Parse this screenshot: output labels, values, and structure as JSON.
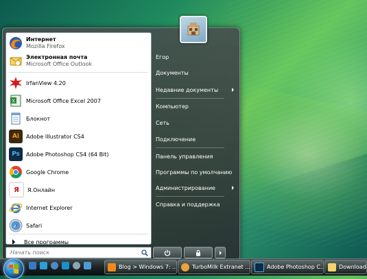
{
  "start_menu": {
    "pinned": [
      {
        "title": "Интернет",
        "subtitle": "Mozilla Firefox",
        "icon": "firefox-icon"
      },
      {
        "title": "Электронная почта",
        "subtitle": "Microsoft Office Outlook",
        "icon": "outlook-icon"
      }
    ],
    "recent": [
      {
        "label": "IrfanView 4.20",
        "icon": "irfanview-icon"
      },
      {
        "label": "Microsoft Office Excel 2007",
        "icon": "excel-icon"
      },
      {
        "label": "Блокнот",
        "icon": "notepad-icon"
      },
      {
        "label": "Adobe Illustrator CS4",
        "icon": "illustrator-icon",
        "icon_text": "Ai"
      },
      {
        "label": "Adobe Photoshop CS4 (64 Bit)",
        "icon": "photoshop-icon",
        "icon_text": "Ps"
      },
      {
        "label": "Google Chrome",
        "icon": "chrome-icon"
      },
      {
        "label": "Я.Онлайн",
        "icon": "yandex-online-icon",
        "icon_text": "Я"
      },
      {
        "label": "Internet Explorer",
        "icon": "ie-icon"
      },
      {
        "label": "Safari",
        "icon": "safari-icon"
      }
    ],
    "all_programs_label": "Все программы",
    "search_placeholder": "Начать поиск",
    "right_items": [
      {
        "label": "Егор",
        "submenu": false
      },
      {
        "label": "Документы",
        "submenu": false
      },
      {
        "label": "Недавние документы",
        "submenu": true
      },
      {
        "label": "Компьютер",
        "submenu": false
      },
      {
        "label": "Сеть",
        "submenu": false
      },
      {
        "label": "Подключение",
        "submenu": false
      },
      {
        "label": "Панель управления",
        "submenu": false
      },
      {
        "label": "Программы по умолчанию",
        "submenu": false
      },
      {
        "label": "Администрирование",
        "submenu": true
      },
      {
        "label": "Справка и поддержка",
        "submenu": false
      }
    ]
  },
  "taskbar": {
    "buttons": [
      {
        "label": "Blog > Windows 7: ...",
        "icon": "firefox-icon"
      },
      {
        "label": "TurboMilk Extranet ...",
        "icon": "turbomilk-icon"
      },
      {
        "label": "Adobe Photoshop C...",
        "icon": "photoshop-icon"
      },
      {
        "label": "Downloads",
        "icon": "folder-icon"
      }
    ]
  },
  "colors": {
    "accent": "#3b86c5",
    "panel_dark": "#3c4646"
  }
}
